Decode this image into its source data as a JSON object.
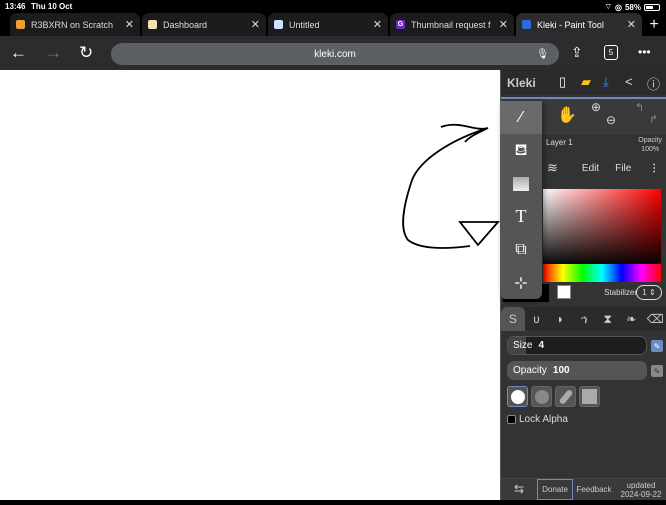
{
  "status_bar": {
    "time": "13:46",
    "date": "Thu 10 Oct",
    "battery": "58%"
  },
  "browser_tabs": [
    {
      "label": "R3BXRN on Scratch",
      "favicon": "scratch-icon",
      "fav_color": "#f0a030",
      "active": false
    },
    {
      "label": "Dashboard",
      "favicon": "dashboard-icon",
      "fav_color": "#f4e3b0",
      "active": false
    },
    {
      "label": "Untitled",
      "favicon": "untitled-icon",
      "fav_color": "#cfe3ff",
      "active": false
    },
    {
      "label": "Thumbnail request f",
      "favicon": "g-icon",
      "fav_color": "#6b2fbf",
      "active": false
    },
    {
      "label": "Kleki - Paint Tool",
      "favicon": "kleki-icon",
      "fav_color": "#2d6bdc",
      "active": true
    }
  ],
  "toolbar": {
    "url": "kleki.com",
    "tab_count": "5"
  },
  "kleki": {
    "logo": "Kleki",
    "layer_name": "Layer 1",
    "opacity_label": "Opacity",
    "opacity_value": "100%",
    "menu": {
      "edit": "Edit",
      "file": "File"
    },
    "hex_label": "#",
    "stabilizer_label": "Stabilizer",
    "stabilizer_value": "1",
    "size_label": "Size",
    "size_value": "4",
    "size_fraction": 0.04,
    "brush_opacity_label": "Opacity",
    "brush_opacity_value": "100",
    "lock_alpha": "Lock Alpha",
    "footer": {
      "donate": "Donate",
      "feedback": "Feedback",
      "updated_label": "updated",
      "updated_date": "2024-09-22"
    },
    "colors": {
      "accent": "#6a8bc4",
      "panel": "#333333",
      "primary_color": "#000000",
      "secondary_color": "#ffffff"
    }
  }
}
